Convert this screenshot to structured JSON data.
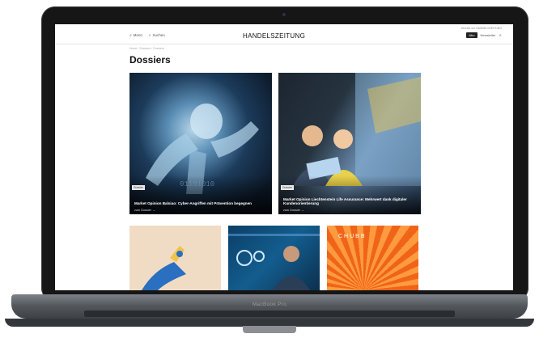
{
  "device": {
    "model_label": "MacBook Pro"
  },
  "screen": {
    "top_small_text": "Service zur HANDELSZEITUNG",
    "nav": {
      "menu_label": "Menü",
      "search_label": "Suchen",
      "abo_label": "Abo",
      "newsletter_label": "Newsletter"
    },
    "brand": "HANDELSZEITUNG",
    "breadcrumb": "Home › Dossiers › Dossiers",
    "page_title": "Dossiers",
    "cards": [
      {
        "tag": "Dossier",
        "title": "Market Opinion Balsiao: Cyber-Angriffen mit Prävention begegnen",
        "link": "zum Dossier →"
      },
      {
        "tag": "Dossier",
        "title": "Market Opinion Liechtenstein Life Assurance: Mehrwert dank digitaler Kundenorientierung",
        "link": "zum Dossier →"
      }
    ],
    "row2": {
      "third_card_brand": "CHUBB"
    }
  }
}
